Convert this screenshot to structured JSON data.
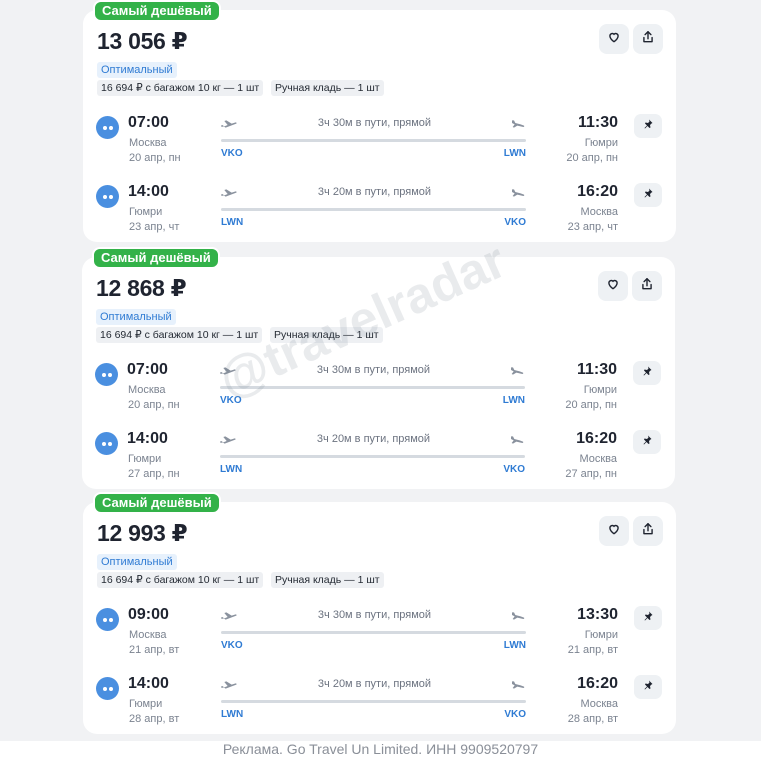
{
  "watermark": "@travelradar",
  "footer": "Реклама. Go Travel Un Limited. ИНН 9909520797",
  "icons": {
    "favorite": "heart-icon",
    "share": "share-icon",
    "pin": "pin-icon",
    "airline": "airline-logo-icon",
    "departure": "plane-takeoff-icon",
    "arrival": "plane-landing-icon"
  },
  "colors": {
    "badge": "#33b249",
    "accent": "#2f7bd3",
    "airline_logo": "#4a8fe0"
  },
  "offers": [
    {
      "badge": "Самый дешёвый",
      "price": "13 056 ₽",
      "tariff": "Оптимальный",
      "baggage": "16 694 ₽ с багажом 10 кг — 1 шт",
      "hand_luggage": "Ручная кладь — 1 шт",
      "legs": [
        {
          "dep_time": "07:00",
          "dep_city": "Москва",
          "dep_date": "20 апр, пн",
          "dep_code": "VKO",
          "duration": "3ч 30м в пути, прямой",
          "arr_time": "11:30",
          "arr_city": "Гюмри",
          "arr_date": "20 апр, пн",
          "arr_code": "LWN"
        },
        {
          "dep_time": "14:00",
          "dep_city": "Гюмри",
          "dep_date": "23 апр, чт",
          "dep_code": "LWN",
          "duration": "3ч 20м в пути, прямой",
          "arr_time": "16:20",
          "arr_city": "Москва",
          "arr_date": "23 апр, чт",
          "arr_code": "VKO"
        }
      ]
    },
    {
      "badge": "Самый дешёвый",
      "price": "12 868 ₽",
      "tariff": "Оптимальный",
      "baggage": "16 694 ₽ с багажом 10 кг — 1 шт",
      "hand_luggage": "Ручная кладь — 1 шт",
      "legs": [
        {
          "dep_time": "07:00",
          "dep_city": "Москва",
          "dep_date": "20 апр, пн",
          "dep_code": "VKO",
          "duration": "3ч 30м в пути, прямой",
          "arr_time": "11:30",
          "arr_city": "Гюмри",
          "arr_date": "20 апр, пн",
          "arr_code": "LWN"
        },
        {
          "dep_time": "14:00",
          "dep_city": "Гюмри",
          "dep_date": "27 апр, пн",
          "dep_code": "LWN",
          "duration": "3ч 20м в пути, прямой",
          "arr_time": "16:20",
          "arr_city": "Москва",
          "arr_date": "27 апр, пн",
          "arr_code": "VKO"
        }
      ]
    },
    {
      "badge": "Самый дешёвый",
      "price": "12 993 ₽",
      "tariff": "Оптимальный",
      "baggage": "16 694 ₽ с багажом 10 кг — 1 шт",
      "hand_luggage": "Ручная кладь — 1 шт",
      "legs": [
        {
          "dep_time": "09:00",
          "dep_city": "Москва",
          "dep_date": "21 апр, вт",
          "dep_code": "VKO",
          "duration": "3ч 30м в пути, прямой",
          "arr_time": "13:30",
          "arr_city": "Гюмри",
          "arr_date": "21 апр, вт",
          "arr_code": "LWN"
        },
        {
          "dep_time": "14:00",
          "dep_city": "Гюмри",
          "dep_date": "28 апр, вт",
          "dep_code": "LWN",
          "duration": "3ч 20м в пути, прямой",
          "arr_time": "16:20",
          "arr_city": "Москва",
          "arr_date": "28 апр, вт",
          "arr_code": "VKO"
        }
      ]
    }
  ]
}
